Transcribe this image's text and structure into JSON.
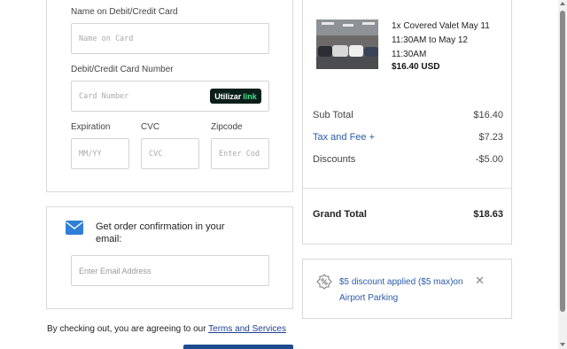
{
  "payment": {
    "name_label": "Name on Debit/Credit Card",
    "name_placeholder": "Name on Card",
    "number_label": "Debit/Credit Card Number",
    "number_placeholder": "Card Number",
    "link_badge_prefix": "Utilizar",
    "link_badge_brand": "link",
    "expiration_label": "Expiration",
    "expiration_placeholder": "MM/YY",
    "cvc_label": "CVC",
    "cvc_placeholder": "CVC",
    "zip_label": "Zipcode",
    "zip_placeholder": "Enter Cod"
  },
  "email": {
    "title": "Get order confirmation in your email:",
    "placeholder": "Enter Email Address"
  },
  "agreement": {
    "text": "By checking out, you are agreeing to our ",
    "link": "Terms and Services"
  },
  "order": {
    "description": "1x Covered Valet May 11 11:30AM to May 12 11:30AM",
    "price": "$16.40 USD"
  },
  "summary": {
    "subtotal_label": "Sub Total",
    "subtotal_value": "$16.40",
    "tax_label": "Tax and Fee +",
    "tax_value": "$7.23",
    "discounts_label": "Discounts",
    "discounts_value": "-$5.00",
    "grand_label": "Grand Total",
    "grand_value": "$18.63"
  },
  "discount_notice": {
    "text": "$5 discount applied ($5 max)on Airport Parking",
    "close": "✕"
  },
  "colors": {
    "link_blue": "#2a5aa8",
    "link_badge_bg": "#0b1f1a",
    "link_badge_green": "#3fe08a",
    "button_blue": "#1f4c8f"
  },
  "icons": [
    "mail-icon",
    "discount-icon",
    "close-icon",
    "parking-photo"
  ]
}
